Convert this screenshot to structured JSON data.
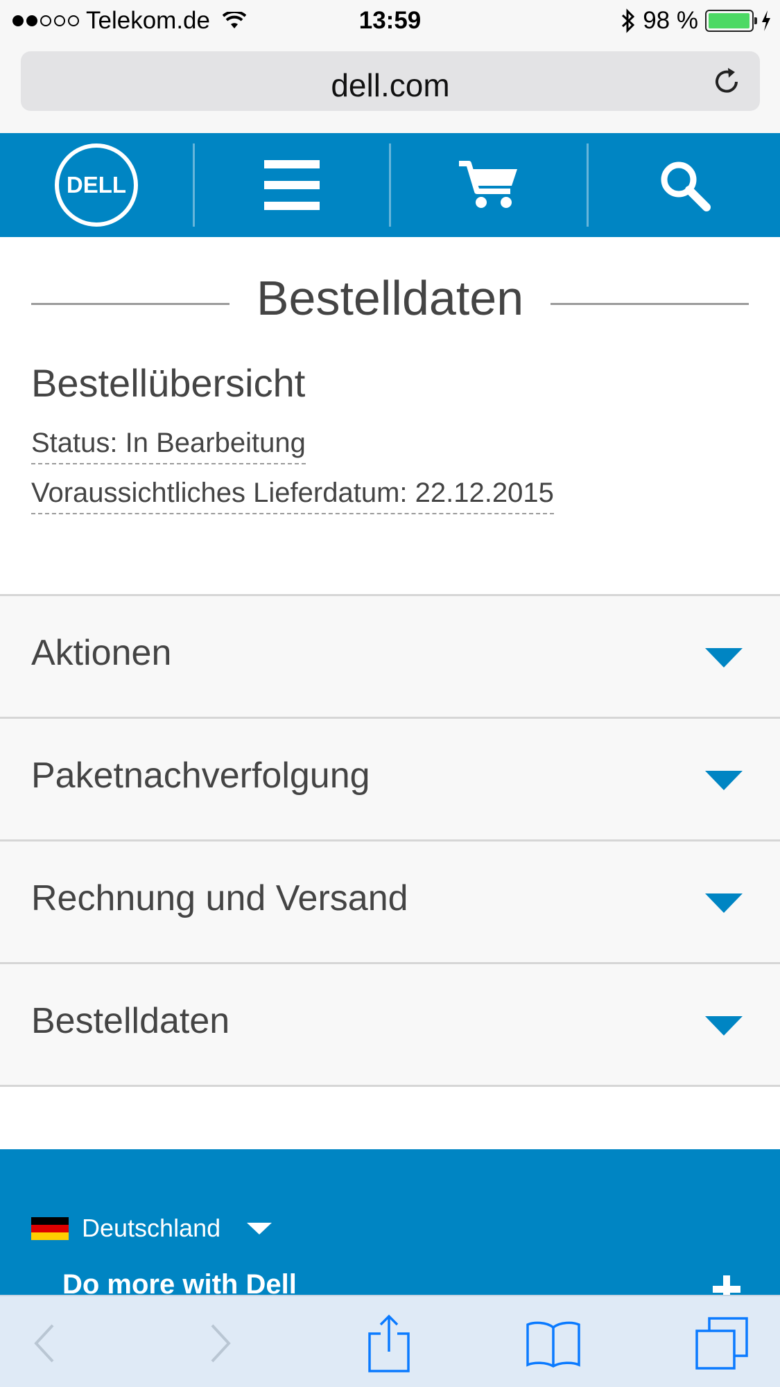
{
  "status_bar": {
    "carrier": "Telekom.de",
    "time": "13:59",
    "battery_percent": "98 %",
    "battery_level": 0.98
  },
  "browser": {
    "url": "dell.com"
  },
  "nav": {
    "logo_text": "DELL",
    "accent_color": "#0085c3"
  },
  "page": {
    "title": "Bestelldaten",
    "subtitle": "Bestellübersicht",
    "status_line": "Status: In Bearbeitung",
    "delivery_line": "Voraussichtliches Lieferdatum: 22.12.2015"
  },
  "accordion": [
    {
      "label": "Aktionen"
    },
    {
      "label": "Paketnachverfolgung"
    },
    {
      "label": "Rechnung und Versand"
    },
    {
      "label": "Bestelldaten"
    }
  ],
  "footer": {
    "country": "Deutschland",
    "do_more": "Do more with Dell"
  }
}
